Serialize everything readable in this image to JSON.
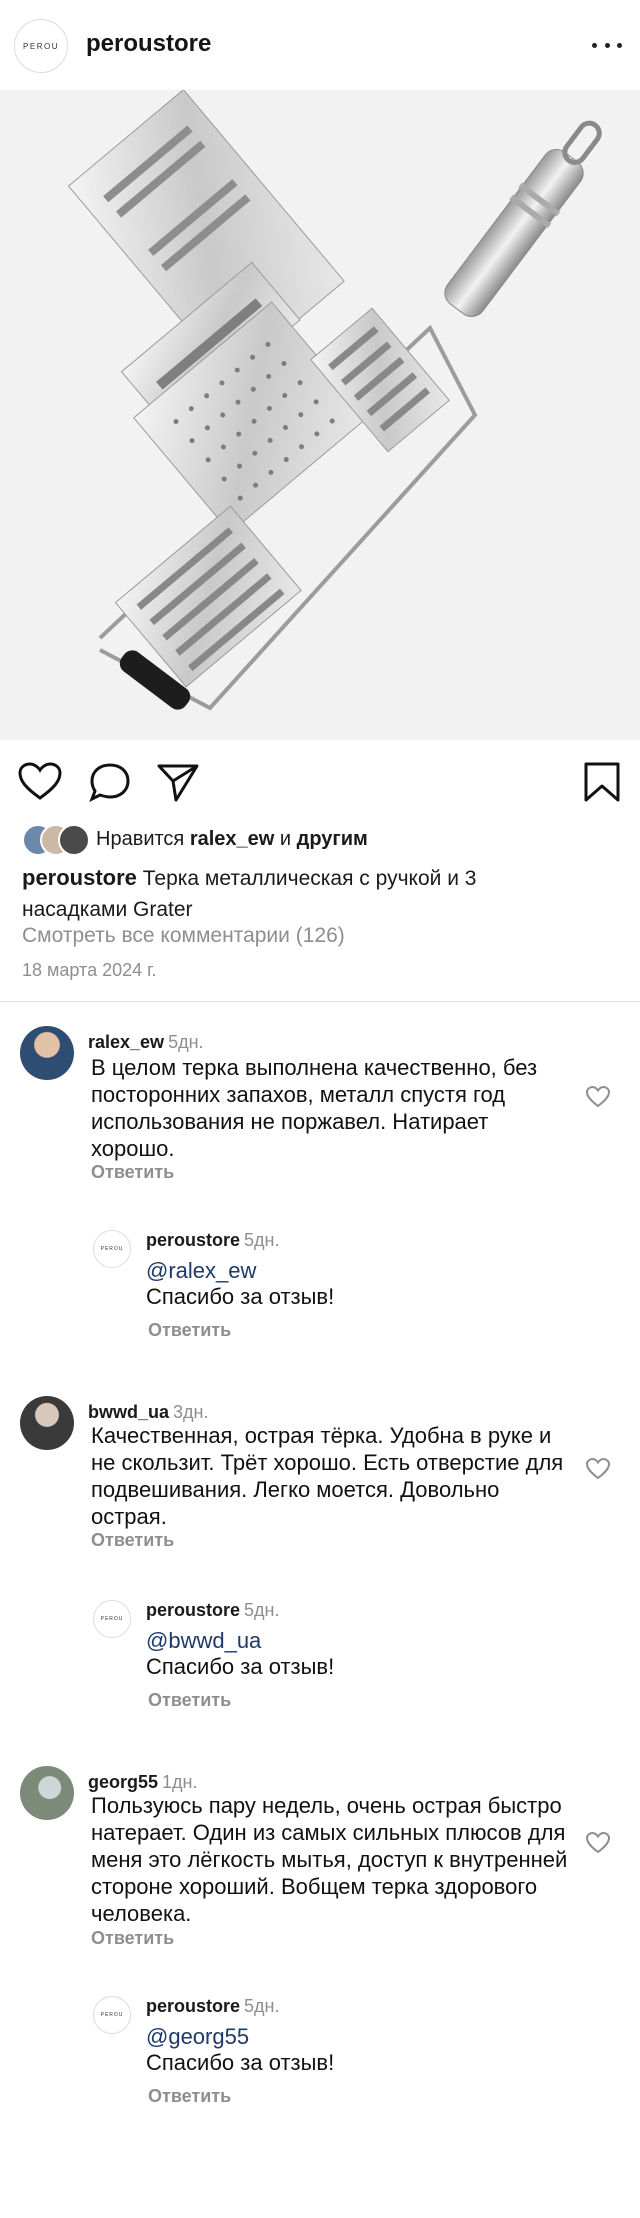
{
  "header": {
    "brand_mark": "PEROU",
    "account": "peroustore"
  },
  "post": {
    "image_alt": "Терка металлическая с ручкой и 3 насадками",
    "likes_prefix": "Нравится",
    "likes_user": "ralex_ew",
    "likes_and": "и",
    "likes_others": "другим",
    "caption_user": "peroustore",
    "caption_text": "Терка металлическая с ручкой и 3 насадками Grater",
    "view_all": "Смотреть все комментарии (126)",
    "date": "18 марта 2024 г."
  },
  "icons": {
    "like": "heart-icon",
    "comment": "comment-icon",
    "share": "paper-plane-icon",
    "save": "bookmark-icon",
    "more": "more-horizontal-icon"
  },
  "comments": [
    {
      "user": "ralex_ew",
      "age": "5дн.",
      "text": "В целом терка выполнена качественно, без посторонних запахов, металл спустя год использования не поржавел. Натирает хорошо.",
      "reply_label": "Ответить",
      "reply": {
        "brand_mark": "PEROU",
        "user": "peroustore",
        "age": "5дн.",
        "mention": "@ralex_ew",
        "text": "Спасибо за отзыв!",
        "reply_label": "Ответить"
      }
    },
    {
      "user": "bwwd_ua",
      "age": "3дн.",
      "text": "Качественная, острая тёрка. Удобна в руке и не скользит. Трёт хорошо. Есть отверстие для подвешивания. Легко моется. Довольно острая.",
      "reply_label": "Ответить",
      "reply": {
        "brand_mark": "PEROU",
        "user": "peroustore",
        "age": "5дн.",
        "mention": "@bwwd_ua",
        "text": "Спасибо за отзыв!",
        "reply_label": "Ответить"
      }
    },
    {
      "user": "georg55",
      "age": "1дн.",
      "text": "Пользуюсь пару недель, очень острая быстро натерает. Один из самых сильных плюсов для меня это лёгкость мытья, доступ к внутренней стороне хороший. Вобщем терка здорового человека.",
      "reply_label": "Ответить",
      "reply": {
        "brand_mark": "PEROU",
        "user": "peroustore",
        "age": "5дн.",
        "mention": "@georg55",
        "text": "Спасибо за отзыв!",
        "reply_label": "Ответить"
      }
    }
  ]
}
